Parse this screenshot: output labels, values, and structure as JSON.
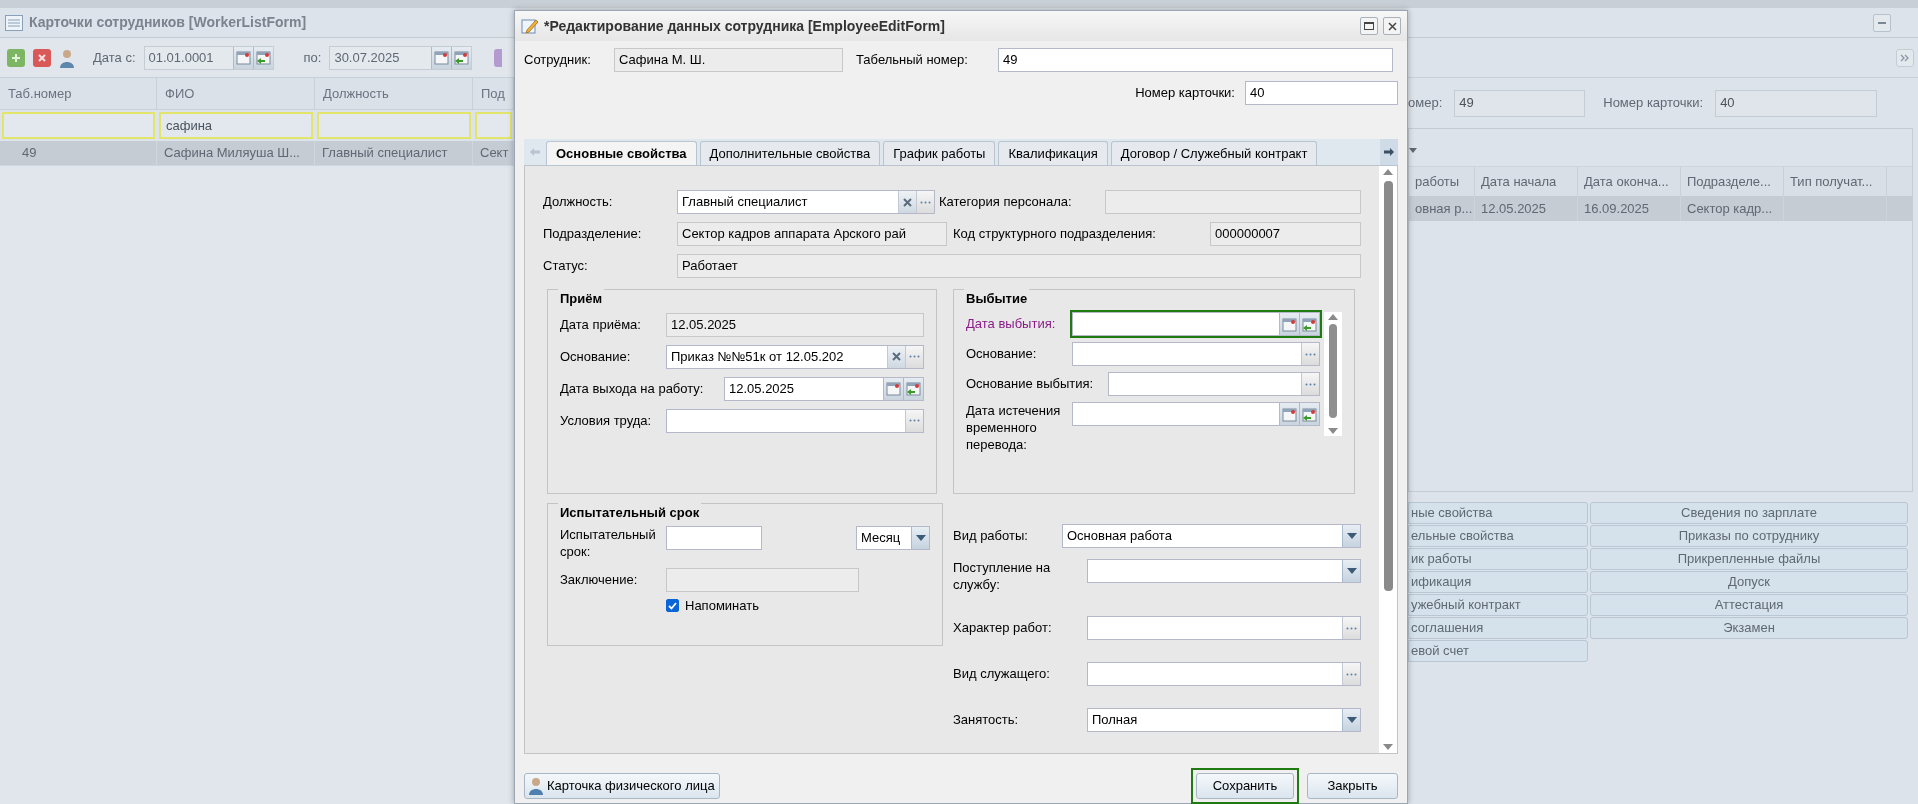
{
  "list_window": {
    "title": "Карточки сотрудников [WorkerListForm]",
    "toolbar": {
      "date_from_label": "Дата с:",
      "date_from": "01.01.0001",
      "date_to_label": "по:",
      "date_to": "30.07.2025"
    },
    "table": {
      "columns": [
        {
          "label": "Таб.номер"
        },
        {
          "label": "ФИО",
          "filter": "сафина"
        },
        {
          "label": "Должность"
        },
        {
          "label": "Под"
        }
      ],
      "rows": [
        {
          "cells": [
            "49",
            "Сафина Миляуша Ш...",
            "Главный специалист",
            "Сект"
          ],
          "selected": true
        }
      ]
    }
  },
  "detail_panel": {
    "fields": [
      {
        "label": "омер:",
        "value": "49"
      },
      {
        "label": "Номер карточки:",
        "value": "40"
      }
    ],
    "grid": {
      "columns": [
        "работы",
        "Дата начала",
        "Дата оконча...",
        "Подразделе...",
        "Тип получат..."
      ],
      "rows": [
        {
          "cells": [
            "овная р...",
            "12.05.2025",
            "16.09.2025",
            "Сектор кадр..."
          ],
          "selected": true
        }
      ]
    },
    "buttons_left": [
      "ные свойства",
      "ельные свойства",
      "ик работы",
      "ификация",
      "ужебный контракт",
      "соглашения",
      "евой счет"
    ],
    "buttons_right": [
      "Сведения по зарплате",
      "Приказы по сотруднику",
      "Прикрепленные файлы",
      "Допуск",
      "Аттестация",
      "Экзамен"
    ]
  },
  "dialog": {
    "title": "*Редактирование данных сотрудника [EmployeeEditForm]",
    "employee": {
      "label": "Сотрудник:",
      "value": "Сафина М. Ш.",
      "kind": "readonly"
    },
    "tab_number": {
      "label": "Табельный номер:",
      "value": "49",
      "kind": "text"
    },
    "card_number": {
      "label": "Номер карточки:",
      "value": "40",
      "kind": "text"
    },
    "tabs": [
      {
        "label": "Основные свойства",
        "selected": true
      },
      {
        "label": "Дополнительные свойства",
        "selected": false
      },
      {
        "label": "График работы",
        "selected": false
      },
      {
        "label": "Квалификация",
        "selected": false
      },
      {
        "label": "Договор / Служебный контракт",
        "selected": false
      }
    ],
    "position": {
      "label": "Должность:",
      "value": "Главный специалист",
      "kind": "lookup",
      "clearable": true
    },
    "staff_category": {
      "label": "Категория персонала:",
      "kind": "readonly"
    },
    "department": {
      "label": "Подразделение:",
      "value": "Сектор кадров аппарата Арского рай",
      "kind": "readonly"
    },
    "department_code": {
      "label": "Код структурного подразделения:",
      "value": "000000007",
      "kind": "readonly"
    },
    "status": {
      "label": "Статус:",
      "value": "Работает",
      "kind": "readonly"
    },
    "hiring": {
      "title": "Приём",
      "fields": [
        {
          "label": "Дата приёма:",
          "value": "12.05.2025",
          "kind": "readonly"
        },
        {
          "label": "Основание:",
          "value": "Приказ №№51к от 12.05.202",
          "kind": "lookup",
          "clearable": true
        },
        {
          "label": "Дата выхода на работу:",
          "value": "12.05.2025",
          "kind": "date"
        },
        {
          "label": "Условия труда:",
          "kind": "lookup"
        }
      ]
    },
    "leaving": {
      "title": "Выбытие",
      "fields": [
        {
          "label": "Дата выбытия:",
          "kind": "date",
          "accent": true,
          "highlighted": true
        },
        {
          "label": "Основание:",
          "kind": "lookup"
        },
        {
          "label": "Основание выбытия:",
          "kind": "lookup"
        },
        {
          "label": "Дата истечения временного перевода:",
          "kind": "date"
        }
      ]
    },
    "probation": {
      "title": "Испытательный срок",
      "period": {
        "label": "Испытательный срок:",
        "kind": "text"
      },
      "unit": {
        "value": "Месяц",
        "kind": "combo"
      },
      "conclusion": {
        "label": "Заключение:",
        "kind": "readonly"
      },
      "remind": {
        "label": "Напоминать",
        "checked": true
      }
    },
    "work_fields": [
      {
        "label": "Вид работы:",
        "value": "Основная работа",
        "kind": "combo"
      },
      {
        "label": "Поступление на службу:",
        "kind": "combo"
      },
      {
        "label": "Характер работ:",
        "kind": "lookup"
      },
      {
        "label": "Вид служащего:",
        "kind": "lookup"
      },
      {
        "label": "Занятость:",
        "value": "Полная",
        "kind": "combo"
      }
    ],
    "person_button": "Карточка физического лица",
    "save_button": {
      "label": "Сохранить",
      "highlighted": true
    },
    "close_button": "Закрыть"
  }
}
